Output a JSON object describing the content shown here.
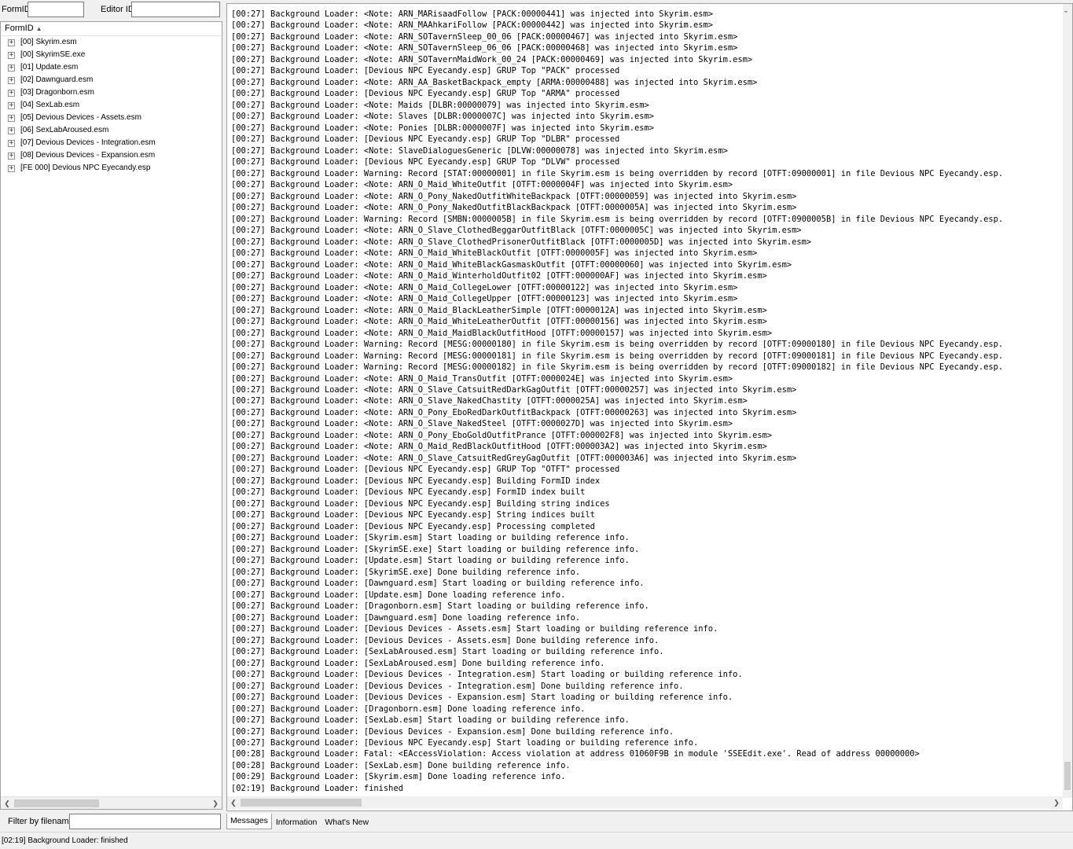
{
  "search": {
    "formid_label": "FormID",
    "editorid_label": "Editor ID",
    "formid_value": "",
    "editorid_value": ""
  },
  "tree": {
    "column_header": "FormID",
    "sort_icon": "sort-ascending-icon",
    "items": [
      "[00] Skyrim.esm",
      "[00] SkyrimSE.exe",
      "[01] Update.esm",
      "[02] Dawnguard.esm",
      "[03] Dragonborn.esm",
      "[04] SexLab.esm",
      "[05] Devious Devices - Assets.esm",
      "[06] SexLabAroused.esm",
      "[07] Devious Devices - Integration.esm",
      "[08] Devious Devices - Expansion.esm",
      "[FE 000] Devious NPC Eyecandy.esp"
    ]
  },
  "filter": {
    "label": "Filter by filename:",
    "value": ""
  },
  "messages": [
    "[00:27] Background Loader: <Note: ARN_MARisaadFollow [PACK:00000441] was injected into Skyrim.esm>",
    "[00:27] Background Loader: <Note: ARN_MAAhkariFollow [PACK:00000442] was injected into Skyrim.esm>",
    "[00:27] Background Loader: <Note: ARN_SOTavernSleep_00_06 [PACK:00000467] was injected into Skyrim.esm>",
    "[00:27] Background Loader: <Note: ARN_SOTavernSleep_06_06 [PACK:00000468] was injected into Skyrim.esm>",
    "[00:27] Background Loader: <Note: ARN_SOTavernMaidWork_00_24 [PACK:00000469] was injected into Skyrim.esm>",
    "[00:27] Background Loader: [Devious NPC Eyecandy.esp] GRUP Top \"PACK\" processed",
    "[00:27] Background Loader: <Note: ARN_AA_BasketBackpack_empty [ARMA:00000488] was injected into Skyrim.esm>",
    "[00:27] Background Loader: [Devious NPC Eyecandy.esp] GRUP Top \"ARMA\" processed",
    "[00:27] Background Loader: <Note: Maids [DLBR:00000079] was injected into Skyrim.esm>",
    "[00:27] Background Loader: <Note: Slaves [DLBR:0000007C] was injected into Skyrim.esm>",
    "[00:27] Background Loader: <Note: Ponies [DLBR:0000007F] was injected into Skyrim.esm>",
    "[00:27] Background Loader: [Devious NPC Eyecandy.esp] GRUP Top \"DLBR\" processed",
    "[00:27] Background Loader: <Note: SlaveDialoguesGeneric [DLVW:00000078] was injected into Skyrim.esm>",
    "[00:27] Background Loader: [Devious NPC Eyecandy.esp] GRUP Top \"DLVW\" processed",
    "[00:27] Background Loader: Warning: Record [STAT:00000001] in file Skyrim.esm is being overridden by record [OTFT:09000001] in file Devious NPC Eyecandy.esp.",
    "[00:27] Background Loader: <Note: ARN_O_Maid_WhiteOutfit [OTFT:0000004F] was injected into Skyrim.esm>",
    "[00:27] Background Loader: <Note: ARN_O_Pony_NakedOutfitWhiteBackpack [OTFT:00000059] was injected into Skyrim.esm>",
    "[00:27] Background Loader: <Note: ARN_O_Pony_NakedOutfitBlackBackpack [OTFT:0000005A] was injected into Skyrim.esm>",
    "[00:27] Background Loader: Warning: Record [SMBN:0000005B] in file Skyrim.esm is being overridden by record [OTFT:0900005B] in file Devious NPC Eyecandy.esp.",
    "[00:27] Background Loader: <Note: ARN_O_Slave_ClothedBeggarOutfitBlack [OTFT:0000005C] was injected into Skyrim.esm>",
    "[00:27] Background Loader: <Note: ARN_O_Slave_ClothedPrisonerOutfitBlack [OTFT:0000005D] was injected into Skyrim.esm>",
    "[00:27] Background Loader: <Note: ARN_O_Maid_WhiteBlackOutfit [OTFT:0000005F] was injected into Skyrim.esm>",
    "[00:27] Background Loader: <Note: ARN_O_Maid_WhiteBlackGasmaskOutfit [OTFT:00000060] was injected into Skyrim.esm>",
    "[00:27] Background Loader: <Note: ARN_O_Maid_WinterholdOutfit02 [OTFT:000000AF] was injected into Skyrim.esm>",
    "[00:27] Background Loader: <Note: ARN_O_Maid_CollegeLower [OTFT:00000122] was injected into Skyrim.esm>",
    "[00:27] Background Loader: <Note: ARN_O_Maid_CollegeUpper [OTFT:00000123] was injected into Skyrim.esm>",
    "[00:27] Background Loader: <Note: ARN_O_Maid_BlackLeatherSimple [OTFT:0000012A] was injected into Skyrim.esm>",
    "[00:27] Background Loader: <Note: ARN_O_Maid_WhiteLeatherOutfit [OTFT:00000156] was injected into Skyrim.esm>",
    "[00:27] Background Loader: <Note: ARN_O_Maid_MaidBlackOutfitHood [OTFT:00000157] was injected into Skyrim.esm>",
    "[00:27] Background Loader: Warning: Record [MESG:00000180] in file Skyrim.esm is being overridden by record [OTFT:09000180] in file Devious NPC Eyecandy.esp.",
    "[00:27] Background Loader: Warning: Record [MESG:00000181] in file Skyrim.esm is being overridden by record [OTFT:09000181] in file Devious NPC Eyecandy.esp.",
    "[00:27] Background Loader: Warning: Record [MESG:00000182] in file Skyrim.esm is being overridden by record [OTFT:09000182] in file Devious NPC Eyecandy.esp.",
    "[00:27] Background Loader: <Note: ARN_O_Maid_TransOutfit [OTFT:0000024E] was injected into Skyrim.esm>",
    "[00:27] Background Loader: <Note: ARN_O_Slave_CatsuitRedDarkGagOutfit [OTFT:00000257] was injected into Skyrim.esm>",
    "[00:27] Background Loader: <Note: ARN_O_Slave_NakedChastity [OTFT:0000025A] was injected into Skyrim.esm>",
    "[00:27] Background Loader: <Note: ARN_O_Pony_EboRedDarkOutfitBackpack [OTFT:00000263] was injected into Skyrim.esm>",
    "[00:27] Background Loader: <Note: ARN_O_Slave_NakedSteel [OTFT:0000027D] was injected into Skyrim.esm>",
    "[00:27] Background Loader: <Note: ARN_O_Pony_EboGoldOutfitPrance [OTFT:000002F8] was injected into Skyrim.esm>",
    "[00:27] Background Loader: <Note: ARN_O_Maid_RedBlackOutfitHood [OTFT:000003A2] was injected into Skyrim.esm>",
    "[00:27] Background Loader: <Note: ARN_O_Slave_CatsuitRedGreyGagOutfit [OTFT:000003A6] was injected into Skyrim.esm>",
    "[00:27] Background Loader: [Devious NPC Eyecandy.esp] GRUP Top \"OTFT\" processed",
    "[00:27] Background Loader: [Devious NPC Eyecandy.esp] Building FormID index",
    "[00:27] Background Loader: [Devious NPC Eyecandy.esp] FormID index built",
    "[00:27] Background Loader: [Devious NPC Eyecandy.esp] Building string indices",
    "[00:27] Background Loader: [Devious NPC Eyecandy.esp] String indices built",
    "[00:27] Background Loader: [Devious NPC Eyecandy.esp] Processing completed",
    "[00:27] Background Loader: [Skyrim.esm] Start loading or building reference info.",
    "[00:27] Background Loader: [SkyrimSE.exe] Start loading or building reference info.",
    "[00:27] Background Loader: [Update.esm] Start loading or building reference info.",
    "[00:27] Background Loader: [SkyrimSE.exe] Done building reference info.",
    "[00:27] Background Loader: [Dawnguard.esm] Start loading or building reference info.",
    "[00:27] Background Loader: [Update.esm] Done loading reference info.",
    "[00:27] Background Loader: [Dragonborn.esm] Start loading or building reference info.",
    "[00:27] Background Loader: [Dawnguard.esm] Done loading reference info.",
    "[00:27] Background Loader: [Devious Devices - Assets.esm] Start loading or building reference info.",
    "[00:27] Background Loader: [Devious Devices - Assets.esm] Done building reference info.",
    "[00:27] Background Loader: [SexLabAroused.esm] Start loading or building reference info.",
    "[00:27] Background Loader: [SexLabAroused.esm] Done building reference info.",
    "[00:27] Background Loader: [Devious Devices - Integration.esm] Start loading or building reference info.",
    "[00:27] Background Loader: [Devious Devices - Integration.esm] Done building reference info.",
    "[00:27] Background Loader: [Devious Devices - Expansion.esm] Start loading or building reference info.",
    "[00:27] Background Loader: [Dragonborn.esm] Done loading reference info.",
    "[00:27] Background Loader: [SexLab.esm] Start loading or building reference info.",
    "[00:27] Background Loader: [Devious Devices - Expansion.esm] Done building reference info.",
    "[00:27] Background Loader: [Devious NPC Eyecandy.esp] Start loading or building reference info.",
    "[00:28] Background Loader: Fatal: <EAccessViolation: Access violation at address 01060F9B in module 'SSEEdit.exe'. Read of address 00000000>",
    "[00:28] Background Loader: [SexLab.esm] Done building reference info.",
    "[00:29] Background Loader: [Skyrim.esm] Done loading reference info.",
    "[02:19] Background Loader: finished"
  ],
  "tabs": [
    {
      "label": "Messages",
      "active": true
    },
    {
      "label": "Information",
      "active": false
    },
    {
      "label": "What's New",
      "active": false
    }
  ],
  "status": {
    "text": "[02:19] Background Loader: finished"
  },
  "icons": {
    "expand": "plus-box-icon",
    "scroll_left": "arrow-left-icon",
    "scroll_right": "arrow-right-icon",
    "scroll_down": "arrow-down-icon"
  },
  "colors": {
    "window_bg": "#f0f0f0",
    "panel_bg": "#ffffff",
    "border": "#a0a0a0",
    "scroll_thumb": "#cdcdcd"
  }
}
